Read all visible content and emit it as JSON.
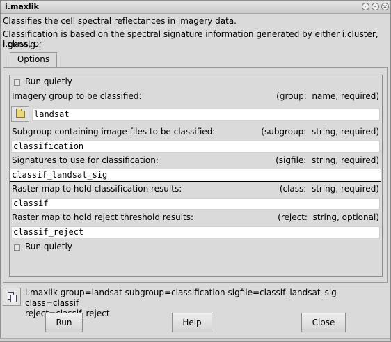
{
  "window": {
    "title": "i.maxlik"
  },
  "description": {
    "line1": "Classifies the cell spectral reflectances in imagery data.",
    "line2": "Classification is based on the spectral signature information generated by either i.cluster, i.class, or",
    "line3": "i.gensig."
  },
  "tabs": [
    {
      "label": "Options"
    }
  ],
  "options": {
    "run_quietly_top": "Run quietly",
    "group": {
      "label": "Imagery group to be classified:",
      "req": "(group:  name, required)",
      "value": "landsat"
    },
    "subgroup": {
      "label": "Subgroup containing image files to be classified:",
      "req": "(subgroup:  string, required)",
      "value": "classification"
    },
    "sigfile": {
      "label": "Signatures to use for classification:",
      "req": "(sigfile:  string, required)",
      "value": "classif_landsat_sig"
    },
    "class": {
      "label": "Raster map to hold classification results:",
      "req": "(class:  string, required)",
      "value": "classif"
    },
    "reject": {
      "label": "Raster map to hold reject threshold results:",
      "req": "(reject:  string, optional)",
      "value": "classif_reject"
    },
    "run_quietly_bottom": "Run quietly"
  },
  "command": {
    "line1": "i.maxlik group=landsat subgroup=classification sigfile=classif_landsat_sig class=classif",
    "line2": "reject=classif_reject"
  },
  "buttons": {
    "run": "Run",
    "help": "Help",
    "close": "Close"
  },
  "icons": {
    "browse": "folder-icon",
    "copy": "copy-icon"
  }
}
